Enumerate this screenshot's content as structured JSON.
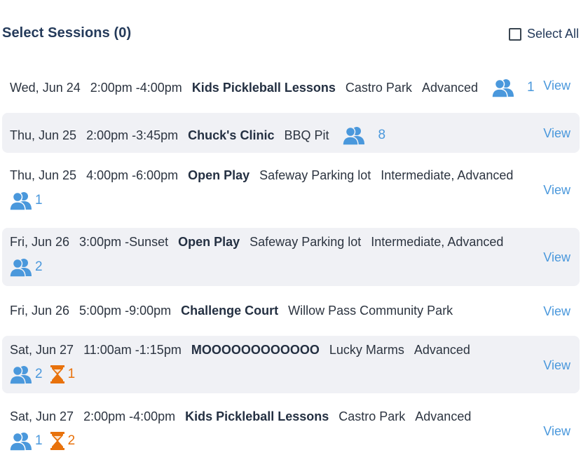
{
  "header": {
    "title": "Select Sessions (0)",
    "select_all_label": "Select All"
  },
  "colors": {
    "accent_blue": "#4a98dc",
    "waitlist_orange": "#e8720c",
    "row_shade": "#f0f1f5",
    "heading": "#243a5a"
  },
  "sessions": [
    {
      "date": "Wed, Jun 24",
      "time": "2:00pm -4:00pm",
      "name": "Kids Pickleball Lessons",
      "location": "Castro Park",
      "level": "Advanced",
      "players": "1",
      "waitlist": "",
      "view_label": "View"
    },
    {
      "date": "Thu, Jun 25",
      "time": "2:00pm -3:45pm",
      "name": "Chuck's Clinic",
      "location": "BBQ Pit",
      "level": "",
      "players": "8",
      "waitlist": "",
      "view_label": "View"
    },
    {
      "date": "Thu, Jun 25",
      "time": "4:00pm -6:00pm",
      "name": "Open Play",
      "location": "Safeway Parking lot",
      "level": "Intermediate, Advanced",
      "players": "1",
      "waitlist": "",
      "view_label": "View"
    },
    {
      "date": "Fri, Jun 26",
      "time": "3:00pm -Sunset",
      "name": "Open Play",
      "location": "Safeway Parking lot",
      "level": "Intermediate, Advanced",
      "players": "2",
      "waitlist": "",
      "view_label": "View"
    },
    {
      "date": "Fri, Jun 26",
      "time": "5:00pm -9:00pm",
      "name": "Challenge Court",
      "location": "Willow Pass Community Park",
      "level": "",
      "players": "",
      "waitlist": "",
      "view_label": "View"
    },
    {
      "date": "Sat, Jun 27",
      "time": "11:00am -1:15pm",
      "name": "MOOOOOOOOOOOO",
      "location": "Lucky Marms",
      "level": "Advanced",
      "players": "2",
      "waitlist": "1",
      "view_label": "View"
    },
    {
      "date": "Sat, Jun 27",
      "time": "2:00pm -4:00pm",
      "name": "Kids Pickleball Lessons",
      "location": "Castro Park",
      "level": "Advanced",
      "players": "1",
      "waitlist": "2",
      "view_label": "View"
    }
  ],
  "icons": {
    "players": "people-icon",
    "waitlist": "hourglass-icon",
    "checkbox": "checkbox-icon"
  }
}
